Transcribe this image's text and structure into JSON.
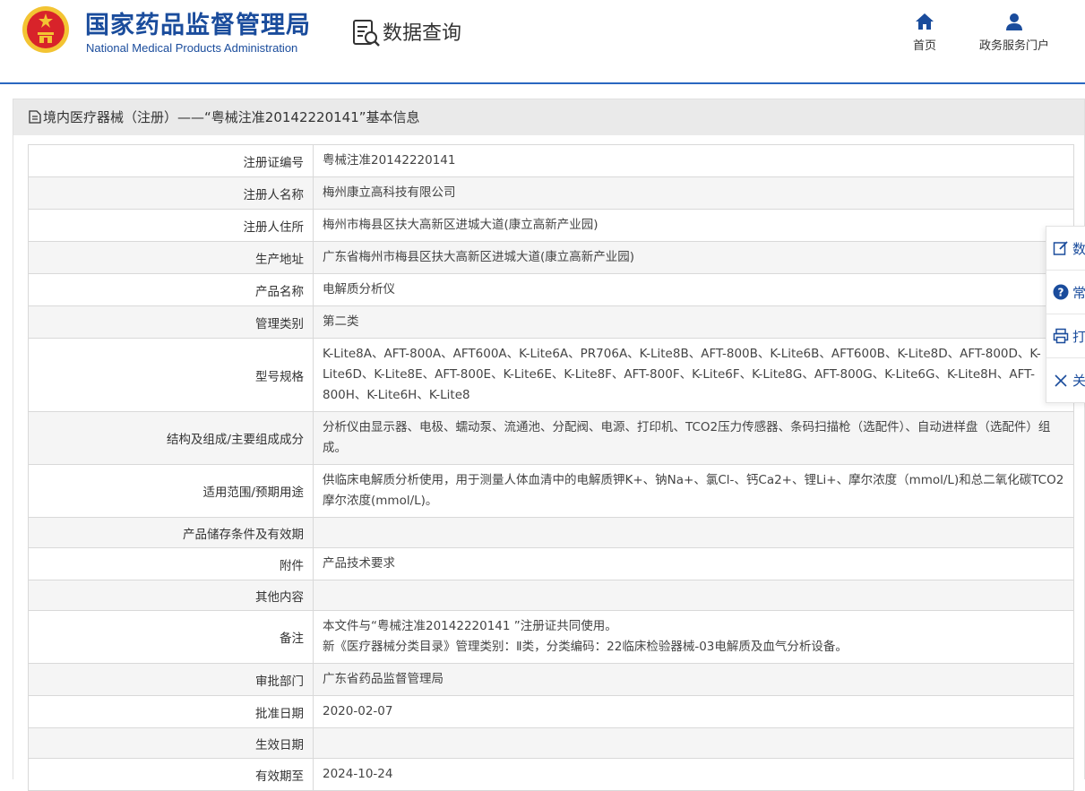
{
  "header": {
    "org_name_cn": "国家药品监督管理局",
    "org_name_en": "National Medical Products Administration",
    "section_title": "数据查询",
    "nav": [
      {
        "label": "首页",
        "icon": "home-icon"
      },
      {
        "label": "政务服务门户",
        "icon": "user-icon"
      }
    ]
  },
  "colors": {
    "brand": "#1a4c9c",
    "accent_line": "#2a67c0",
    "emblem_red": "#d8232a",
    "emblem_gold": "#f3c433"
  },
  "panel": {
    "title": "境内医疗器械（注册）——“粤械注准20142220141”基本信息"
  },
  "fields": [
    {
      "label": "注册证编号",
      "value": "粤械注准20142220141"
    },
    {
      "label": "注册人名称",
      "value": "梅州康立高科技有限公司"
    },
    {
      "label": "注册人住所",
      "value": "梅州市梅县区扶大高新区进城大道(康立高新产业园)"
    },
    {
      "label": "生产地址",
      "value": "广东省梅州市梅县区扶大高新区进城大道(康立高新产业园)"
    },
    {
      "label": "产品名称",
      "value": "电解质分析仪"
    },
    {
      "label": "管理类别",
      "value": "第二类"
    },
    {
      "label": "型号规格",
      "value": "K-Lite8A、AFT-800A、AFT600A、K-Lite6A、PR706A、K-Lite8B、AFT-800B、K-Lite6B、AFT600B、K-Lite8D、AFT-800D、K-Lite6D、K-Lite8E、AFT-800E、K-Lite6E、K-Lite8F、AFT-800F、K-Lite6F、K-Lite8G、AFT-800G、K-Lite6G、K-Lite8H、AFT-800H、K-Lite6H、K-Lite8"
    },
    {
      "label": "结构及组成/主要组成成分",
      "value": "分析仪由显示器、电极、蠕动泵、流通池、分配阀、电源、打印机、TCO2压力传感器、条码扫描枪（选配件）、自动进样盘（选配件）组成。"
    },
    {
      "label": "适用范围/预期用途",
      "value": "供临床电解质分析使用，用于测量人体血清中的电解质钾K+、钠Na+、氯Cl-、钙Ca2+、锂Li+、摩尔浓度（mmol/L)和总二氧化碳TCO2摩尔浓度(mmol/L)。"
    },
    {
      "label": "产品储存条件及有效期",
      "value": ""
    },
    {
      "label": "附件",
      "value": "产品技术要求"
    },
    {
      "label": "其他内容",
      "value": ""
    },
    {
      "label": "备注",
      "value_lines": [
        "本文件与“粤械注准20142220141 ”注册证共同使用。",
        "新《医疗器械分类目录》管理类别：Ⅱ类，分类编码：22临床检验器械-03电解质及血气分析设备。"
      ]
    },
    {
      "label": "审批部门",
      "value": "广东省药品监督管理局"
    },
    {
      "label": "批准日期",
      "value": "2020-02-07"
    },
    {
      "label": "生效日期",
      "value": ""
    },
    {
      "label": "有效期至",
      "value": "2024-10-24"
    }
  ],
  "float_toolbar": [
    {
      "label": "数",
      "icon": "edit-icon"
    },
    {
      "label": "常",
      "icon": "help-icon"
    },
    {
      "label": "打",
      "icon": "print-icon"
    },
    {
      "label": "关",
      "icon": "close-icon"
    }
  ]
}
